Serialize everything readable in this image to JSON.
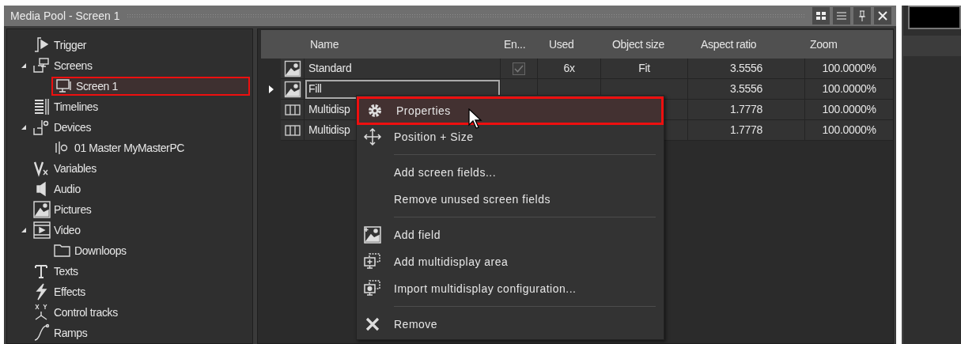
{
  "window": {
    "title": "Media Pool - Screen 1",
    "buttons": [
      {
        "kind": "grid"
      },
      {
        "kind": "list"
      },
      {
        "kind": "pin"
      },
      {
        "kind": "close"
      }
    ]
  },
  "tree": [
    {
      "label": "Trigger",
      "kind": "trigger",
      "selected": false
    },
    {
      "label": "Screens",
      "kind": "screens",
      "selected": false,
      "expanded": true,
      "children": [
        {
          "label": "Screen 1",
          "kind": "screen",
          "selected": true
        }
      ]
    },
    {
      "label": "Timelines",
      "kind": "timelines",
      "selected": false
    },
    {
      "label": "Devices",
      "kind": "devices",
      "selected": false,
      "expanded": true,
      "children": [
        {
          "label": "01 Master MyMasterPC",
          "kind": "device",
          "selected": false
        }
      ]
    },
    {
      "label": "Variables",
      "kind": "variables",
      "selected": false
    },
    {
      "label": "Audio",
      "kind": "audio",
      "selected": false
    },
    {
      "label": "Pictures",
      "kind": "pictures",
      "selected": false
    },
    {
      "label": "Video",
      "kind": "video",
      "selected": false,
      "expanded": true,
      "children": [
        {
          "label": "Downloops",
          "kind": "folder",
          "selected": false
        }
      ]
    },
    {
      "label": "Texts",
      "kind": "texts",
      "selected": false
    },
    {
      "label": "Effects",
      "kind": "effects",
      "selected": false
    },
    {
      "label": "Control tracks",
      "kind": "controltracks",
      "selected": false
    },
    {
      "label": "Ramps",
      "kind": "ramps",
      "selected": false
    }
  ],
  "table": {
    "columns": [
      "Name",
      "En...",
      "Used",
      "Object size",
      "Aspect ratio",
      "Zoom"
    ],
    "rows": [
      {
        "kind": "picture",
        "current": false,
        "name": "Standard",
        "enabled": true,
        "used": "6x",
        "object_size": "Fit",
        "aspect_ratio": "3.5556",
        "zoom": "100.0000%"
      },
      {
        "kind": "picture",
        "current": true,
        "name": "Fill",
        "aspect_ratio": "3.5556",
        "zoom": "100.0000%"
      },
      {
        "kind": "multidisplay",
        "current": false,
        "name": "Multidisp",
        "aspect_ratio": "1.7778",
        "zoom": "100.0000%"
      },
      {
        "kind": "multidisplay",
        "current": false,
        "name": "Multidisp",
        "aspect_ratio": "1.7778",
        "zoom": "100.0000%"
      }
    ]
  },
  "context_menu": [
    {
      "kind": "settings",
      "label": "Properties",
      "selected": true
    },
    {
      "kind": "move",
      "label": "Position + Size",
      "selected": false
    },
    {
      "kind": "separator"
    },
    {
      "kind": "plain",
      "label": "Add screen fields...",
      "selected": false
    },
    {
      "kind": "plain",
      "label": "Remove unused screen fields",
      "selected": false
    },
    {
      "kind": "separator"
    },
    {
      "kind": "addpicture",
      "label": "Add field",
      "selected": false
    },
    {
      "kind": "addmonitor",
      "label": "Add multidisplay area",
      "selected": false
    },
    {
      "kind": "monitorgear",
      "label": "Import multidisplay configuration...",
      "selected": false
    },
    {
      "kind": "separator"
    },
    {
      "kind": "remove",
      "label": "Remove",
      "selected": false
    }
  ]
}
